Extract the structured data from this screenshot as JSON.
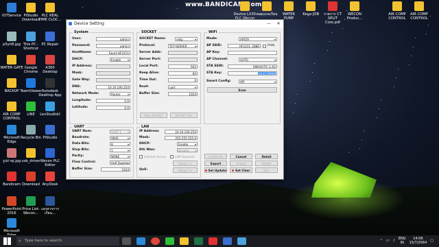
{
  "watermark": "www.BANDICAM.com",
  "desktop_icons_left": [
    {
      "label": "IOTService",
      "color": "#2d7dd2"
    },
    {
      "label": "PiStudio Download",
      "color": "#f2c230"
    },
    {
      "label": "PLC REAL TIME CLOC...",
      "color": "#f2c230"
    },
    {
      "label": "p5yh8.jpg",
      "color": "#9bb"
    },
    {
      "label": "This PC - Shortcut",
      "color": "#4aa3df"
    },
    {
      "label": "PC Repair",
      "color": "#3b6fd8"
    },
    {
      "label": "WATER GATE",
      "color": "#f2c230"
    },
    {
      "label": "Google Chrome",
      "color": "#e0453a"
    },
    {
      "label": "A360 Desktop",
      "color": "#d94545"
    },
    {
      "label": "BACKUP",
      "color": "#f2c230"
    },
    {
      "label": "TeamViewer",
      "color": "#1f7ae0"
    },
    {
      "label": "Autodesk Desktop App",
      "color": "#333"
    },
    {
      "label": "AIR COMP CONTROL",
      "color": "#f2c230"
    },
    {
      "label": "LINE",
      "color": "#2fbf3a"
    },
    {
      "label": "LevStudioU",
      "color": "#3aa0e0"
    },
    {
      "label": "Microsoft Edge",
      "color": "#2a8ad9"
    },
    {
      "label": "Recycle Bin",
      "color": "#8aa"
    },
    {
      "label": "PiStudio",
      "color": "#3a6fd0"
    },
    {
      "label": "รูปถ่ายj.jpg",
      "color": "#c77"
    },
    {
      "label": "usb_driver",
      "color": "#f2c230"
    },
    {
      "label": "Wecon PLC Editor",
      "color": "#2b66d3"
    },
    {
      "label": "Bandicam",
      "color": "#d33"
    },
    {
      "label": "Download",
      "color": "#d8402c"
    },
    {
      "label": "AnyDesk",
      "color": "#e8443a"
    },
    {
      "label": "PowerPoint 2016",
      "color": "#d24726"
    },
    {
      "label": "Price List-Wecon...",
      "color": "#1f9d55"
    },
    {
      "label": "เอกสารการเรียน...",
      "color": "#2b579a"
    },
    {
      "label": "Microsoft Edge",
      "color": "#2a8ad9"
    }
  ],
  "desktop_icons_top": [
    {
      "label": "Device LX3V PLC Wecon",
      "color": "#f2c230"
    },
    {
      "label": "คอมแบบเรียน",
      "color": "#f2c230"
    },
    {
      "label": "WATER PUMP",
      "color": "#f2c230"
    },
    {
      "label": "ข้อมูล JOB",
      "color": "#f2c230"
    },
    {
      "label": "รายการ CT SPLIT Core.pdf",
      "color": "#d33"
    },
    {
      "label": "WECON Produc...",
      "color": "#f2c230"
    },
    {
      "label": "AIR COMP CONTROL",
      "color": "#f2c230"
    },
    {
      "label": "AIR COMP CONTROL",
      "color": "#f2c230"
    }
  ],
  "dialog": {
    "title": "Device Setting",
    "system": {
      "title": "System",
      "user_label": "User:",
      "user_value": "admin",
      "password_label": "Password:",
      "password_value": "admin",
      "hostname_label": "HostName:",
      "hostname_value": "Eport-HF2211",
      "dhcp_label": "DHCP:",
      "dhcp_value": "Enable",
      "ip_label": "IP Address:",
      "mask_label": "Mask:",
      "gateway_label": "Gate Way:",
      "dns_label": "DNS:",
      "dns_value": "10.10.100.254",
      "network_mode_label": "Network Mode:",
      "network_mode_value": "Router",
      "longitude_label": "Longitude:",
      "longitude_value": "0.0",
      "latitude_label": "Latitude:",
      "latitude_value": "0.0"
    },
    "socket": {
      "title": "SOCKET",
      "name_label": "SOCKET Name:",
      "name_value": "netp",
      "protocol_label": "Protocol:",
      "protocol_value": "TCP-SERVER",
      "server_addr_label": "Server Addr:",
      "server_port_label": "Server Port:",
      "local_port_label": "Local Port:",
      "local_port_value": "502",
      "keep_alive_label": "Keep Alive:",
      "keep_alive_value": "60",
      "timeout_label": "Time Out:",
      "timeout_value": "0",
      "route_label": "Rout:",
      "route_value": "uart",
      "buffer_label": "Buffer Size:",
      "buffer_value": "1024",
      "new_btn": "New SOCKET",
      "del_btn": "SOCKET Del"
    },
    "wifi": {
      "title": "WiFi",
      "mode_label": "Mode:",
      "mode_value": "APSTA",
      "ap_ssid_label": "AP SSID:",
      "ap_ssid_value": "HF2211_2B8E",
      "hide_label": "Hide",
      "ap_key_label": "AP Key:",
      "ap_channel_label": "AP Channel:",
      "ap_channel_value": "AUTO",
      "sta_ssid_label": "STA SSID:",
      "sta_ssid_value": "SMHAUTO_2.4G",
      "sta_key_label": "STA Key:",
      "sta_key_value": "024170068",
      "smart_config_label": "Smart Config:",
      "smart_config_value": "Off",
      "scan_btn": "Scan"
    },
    "uart": {
      "title": "UART",
      "num_label": "UART Num:",
      "num_value": "UART 1",
      "baud_label": "Baudrate:",
      "baud_value": "9600",
      "data_label": "Data Bits:",
      "data_value": "8",
      "stop_label": "Stop Bits:",
      "stop_value": "1",
      "parity_label": "Parity:",
      "parity_value": "NONE",
      "flow_label": "Flow Control:",
      "flow_value": "Half Duplex",
      "buffer_label": "Buffer Size:",
      "buffer_value": "1024"
    },
    "lan": {
      "title": "LAN",
      "ip_label": "IP Address:",
      "ip_value": "10.10.100.254",
      "mask_label": "Mask:",
      "mask_value": "255.255.255.0",
      "dhcp_label": "DHCP:",
      "dhcp_value": "Enable",
      "eth_label": "Eth Wan:",
      "eth_value": "Disable",
      "internet_access": "Internet Access",
      "lan_separate": "LAN Separate",
      "qos_label": "QoS:",
      "setup_btn": "Setup >>",
      "setup_btn2": "Setup >>"
    },
    "buttons": {
      "certificate": "Certificate",
      "cancel": "Cancel",
      "detail": "Detail",
      "export": "Export",
      "import": "Import",
      "webpage": "WebPa",
      "set_update": "Set Update",
      "set_clear": "Set Clear",
      "skin": "Skin"
    }
  },
  "taskbar": {
    "search_placeholder": "Type here to search",
    "lang": "ENG",
    "lang2": "IN",
    "time": "14:06",
    "date": "15/7/2564"
  }
}
